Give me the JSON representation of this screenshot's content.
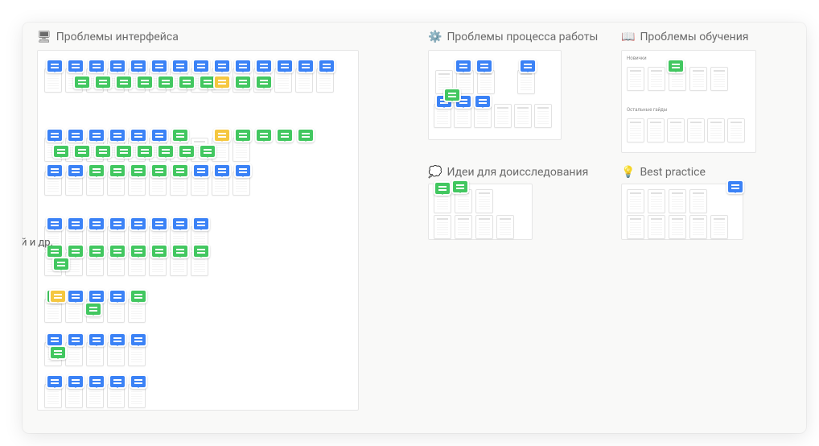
{
  "sections": {
    "s1": {
      "title": "Проблемы интерфейса",
      "icon": "🖥"
    },
    "s2": {
      "title": "Проблемы процесса работы",
      "icon": "⚙️"
    },
    "s3": {
      "title": "Проблемы обучения",
      "icon": "📖"
    },
    "s4": {
      "title": "Идеи для доисследования",
      "icon": "💭"
    },
    "s5": {
      "title": "Best practice",
      "icon": "💡"
    }
  },
  "sublabels": {
    "sub1": "Новички",
    "sub2": "Остальные гайды"
  },
  "sidetext": "й и др.",
  "colors": {
    "pin_blue": "#3b82f6",
    "pin_green": "#42c760",
    "pin_yellow": "#f5c740"
  }
}
